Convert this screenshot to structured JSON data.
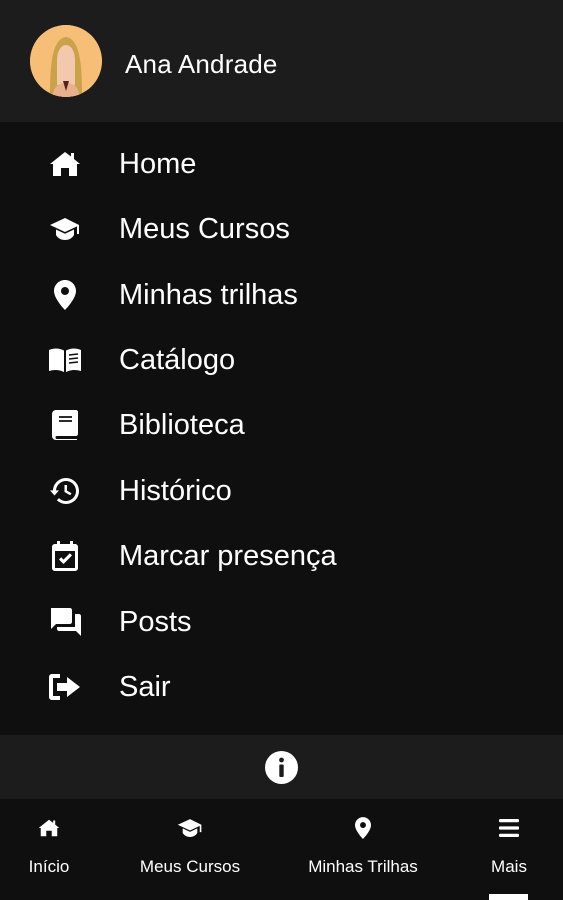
{
  "profile": {
    "name": "Ana Andrade",
    "avatar_icon": "user-avatar-icon"
  },
  "menu": {
    "items": [
      {
        "label": "Home",
        "icon": "home-icon"
      },
      {
        "label": "Meus Cursos",
        "icon": "graduation-cap-icon"
      },
      {
        "label": "Minhas trilhas",
        "icon": "map-pin-icon"
      },
      {
        "label": "Catálogo",
        "icon": "open-book-icon"
      },
      {
        "label": "Biblioteca",
        "icon": "book-icon"
      },
      {
        "label": "Histórico",
        "icon": "history-icon"
      },
      {
        "label": "Marcar presença",
        "icon": "calendar-check-icon"
      },
      {
        "label": "Posts",
        "icon": "chat-icon"
      },
      {
        "label": "Sair",
        "icon": "sign-out-icon"
      }
    ]
  },
  "info": {
    "icon": "info-icon"
  },
  "bottom_nav": {
    "items": [
      {
        "label": "Início",
        "icon": "home-icon"
      },
      {
        "label": "Meus Cursos",
        "icon": "graduation-cap-icon"
      },
      {
        "label": "Minhas Trilhas",
        "icon": "map-pin-icon"
      },
      {
        "label": "Mais",
        "icon": "menu-icon"
      }
    ],
    "active": "Mais"
  },
  "colors": {
    "background": "#0f0f0f",
    "header": "#1c1c1c",
    "text": "#ffffff",
    "avatar_bg": "#f6be76"
  }
}
